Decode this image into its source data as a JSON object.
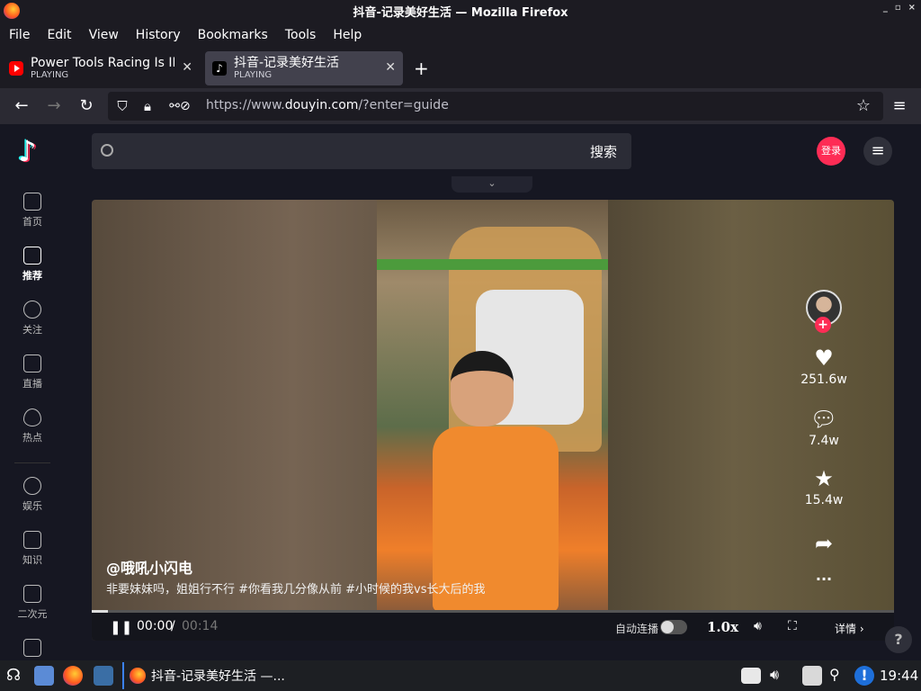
{
  "window": {
    "title": "抖音-记录美好生活 — Mozilla Firefox",
    "controls": [
      "_",
      "▫",
      "×"
    ]
  },
  "menubar": {
    "items": [
      "File",
      "Edit",
      "View",
      "History",
      "Bookmarks",
      "Tools",
      "Help"
    ]
  },
  "tabs": [
    {
      "title": "Power Tools Racing Is INT",
      "status": "PLAYING",
      "icon": "youtube-icon"
    },
    {
      "title": "抖音-记录美好生活",
      "status": "PLAYING",
      "icon": "douyin-icon"
    }
  ],
  "navbar": {
    "url_prefix": "https://www.",
    "url_domain": "douyin.com",
    "url_rest": "/?enter=guide"
  },
  "header": {
    "search_button": "搜索",
    "login_label": "登录"
  },
  "sidebar": {
    "items": [
      {
        "label": "首页",
        "icon": "home-icon",
        "active": false
      },
      {
        "label": "推荐",
        "icon": "thumbs-up-icon",
        "active": true
      },
      {
        "label": "关注",
        "icon": "user-plus-icon",
        "active": false
      },
      {
        "label": "直播",
        "icon": "tv-icon",
        "active": false
      },
      {
        "label": "热点",
        "icon": "flame-icon",
        "active": false
      },
      {
        "label": "娱乐",
        "icon": "smile-icon",
        "active": false
      },
      {
        "label": "知识",
        "icon": "bookmark-icon",
        "active": false
      },
      {
        "label": "二次元",
        "icon": "anime-icon",
        "active": false
      },
      {
        "label": "",
        "icon": "game-icon",
        "active": false
      }
    ]
  },
  "video": {
    "author": "@哦吼小闪电",
    "description": "非要妹妹吗，姐姐行不行 #你看我几分像从前  #小时候的我vs长大后的我",
    "likes": "251.6w",
    "comments": "7.4w",
    "favorites": "15.4w",
    "more": "···",
    "current_time": "00:00",
    "separator": "/",
    "duration": "00:14",
    "progress": 0.02,
    "autoplay_label": "自动连播",
    "speed": "1.0x",
    "details_label": "详情 ›"
  },
  "taskbar": {
    "task_title": "抖音-记录美好生活 —...",
    "clock": "19:44"
  }
}
